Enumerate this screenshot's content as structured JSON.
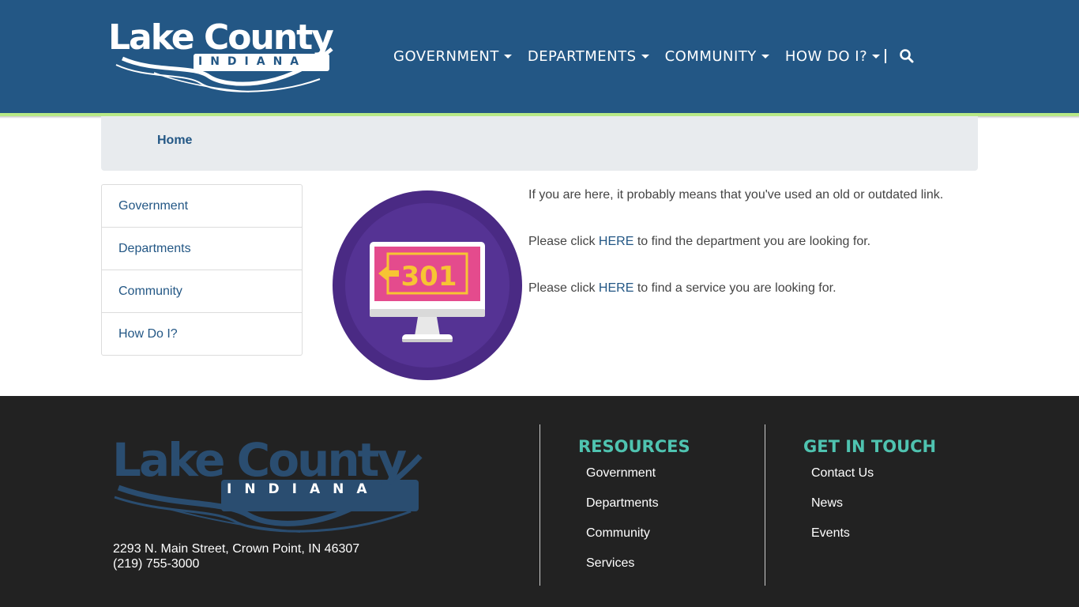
{
  "header": {
    "logo_title": "Lake County",
    "logo_subtitle": "INDIANA",
    "nav": [
      {
        "label": "GOVERNMENT"
      },
      {
        "label": "DEPARTMENTS"
      },
      {
        "label": "COMMUNITY"
      },
      {
        "label": "HOW DO I?"
      }
    ],
    "search_icon": "search-icon"
  },
  "breadcrumb": {
    "home": "Home"
  },
  "sidebar": {
    "items": [
      {
        "label": "Government"
      },
      {
        "label": "Departments"
      },
      {
        "label": "Community"
      },
      {
        "label": "How Do I?"
      }
    ]
  },
  "illustration": {
    "code": "301",
    "icon": "monitor-redirect-icon"
  },
  "content": {
    "line1": "If you are here, it probably means that you've used an old or outdated link.",
    "line2_before": "Please click ",
    "line2_link": "HERE",
    "line2_after": " to find the department you are looking for.",
    "line3_before": "Please click ",
    "line3_link": "HERE",
    "line3_after": " to find a service you are looking for."
  },
  "footer": {
    "logo_title": "Lake County",
    "logo_subtitle": "INDIANA",
    "address": "2293 N. Main Street, Crown Point, IN 46307",
    "phone": "(219) 755-3000",
    "resources": {
      "heading": "RESOURCES",
      "links": [
        {
          "label": "Government"
        },
        {
          "label": "Departments"
        },
        {
          "label": "Community"
        },
        {
          "label": "Services"
        }
      ]
    },
    "contact": {
      "heading": "GET IN TOUCH",
      "links": [
        {
          "label": "Contact Us"
        },
        {
          "label": "News"
        },
        {
          "label": "Events"
        }
      ]
    }
  },
  "colors": {
    "header_bg": "#235785",
    "accent_stripe": "#b8e986",
    "footer_bg": "#222222",
    "footer_heading": "#4fc3b0",
    "link": "#235785"
  }
}
